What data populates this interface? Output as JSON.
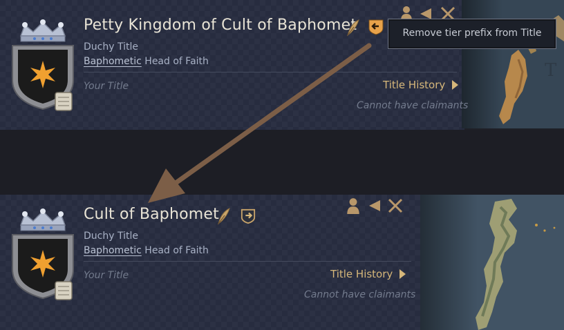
{
  "top_card": {
    "title": "Petty Kingdom of Cult of Baphomet",
    "tier": "Duchy Title",
    "faith": "Baphometic",
    "head_of_faith": " Head of Faith",
    "your_title": "Your Title",
    "history_label": "Title History",
    "claimants": "Cannot have claimants"
  },
  "tooltip": {
    "text": "Remove tier prefix from Title"
  },
  "bottom_card": {
    "title": "Cult of Baphomet",
    "tier": "Duchy Title",
    "faith": "Baphometic",
    "head_of_faith": " Head of Faith",
    "your_title": "Your Title",
    "history_label": "Title History",
    "claimants": "Cannot have claimants"
  },
  "colors": {
    "accent_gold": "#d6b77a",
    "arrow": "#7c5e47",
    "panel": "#272c3f"
  }
}
